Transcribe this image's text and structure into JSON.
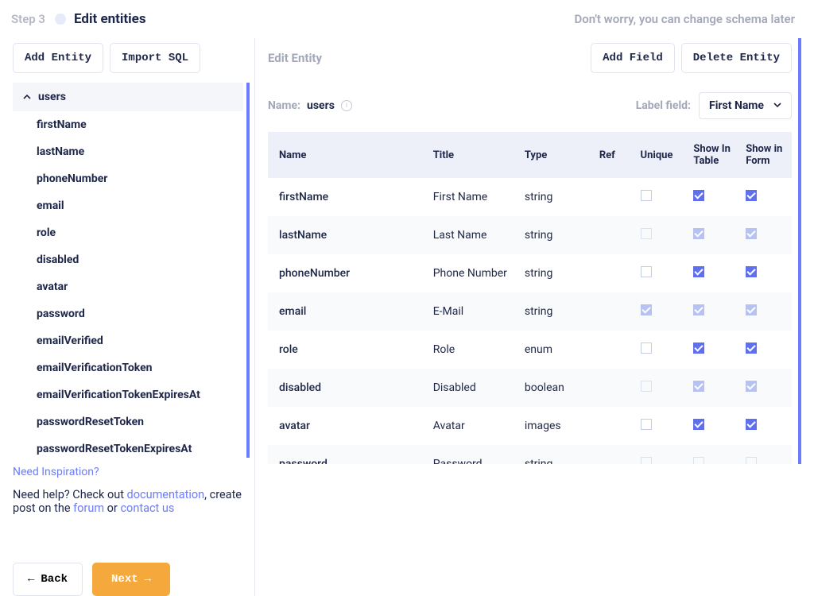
{
  "header": {
    "step_label": "Step 3",
    "title": "Edit entities",
    "subtitle": "Don't worry, you can change schema later"
  },
  "left": {
    "add_entity_label": "Add Entity",
    "import_sql_label": "Import SQL",
    "entity_name": "users",
    "fields": [
      "firstName",
      "lastName",
      "phoneNumber",
      "email",
      "role",
      "disabled",
      "avatar",
      "password",
      "emailVerified",
      "emailVerificationToken",
      "emailVerificationTokenExpiresAt",
      "passwordResetToken",
      "passwordResetTokenExpiresAt"
    ],
    "inspiration": "Need Inspiration?"
  },
  "right": {
    "edit_entity_label": "Edit Entity",
    "add_field_label": "Add Field",
    "delete_entity_label": "Delete Entity",
    "name_label": "Name:",
    "name_value": "users",
    "label_field_label": "Label field:",
    "label_field_value": "First Name",
    "columns": {
      "name": "Name",
      "title": "Title",
      "type": "Type",
      "ref": "Ref",
      "unique": "Unique",
      "show_in_table": "Show In Table",
      "show_in_form": "Show in Form"
    },
    "rows": [
      {
        "name": "firstName",
        "title": "First Name",
        "type": "string",
        "ref": "",
        "unique": false,
        "show_in_table": true,
        "show_in_form": true,
        "muted": false
      },
      {
        "name": "lastName",
        "title": "Last Name",
        "type": "string",
        "ref": "",
        "unique": false,
        "show_in_table": true,
        "show_in_form": true,
        "muted": true
      },
      {
        "name": "phoneNumber",
        "title": "Phone Number",
        "type": "string",
        "ref": "",
        "unique": false,
        "show_in_table": true,
        "show_in_form": true,
        "muted": false
      },
      {
        "name": "email",
        "title": "E-Mail",
        "type": "string",
        "ref": "",
        "unique": true,
        "show_in_table": true,
        "show_in_form": true,
        "muted": true
      },
      {
        "name": "role",
        "title": "Role",
        "type": "enum",
        "ref": "",
        "unique": false,
        "show_in_table": true,
        "show_in_form": true,
        "muted": false
      },
      {
        "name": "disabled",
        "title": "Disabled",
        "type": "boolean",
        "ref": "",
        "unique": false,
        "show_in_table": true,
        "show_in_form": true,
        "muted": true
      },
      {
        "name": "avatar",
        "title": "Avatar",
        "type": "images",
        "ref": "",
        "unique": false,
        "show_in_table": true,
        "show_in_form": true,
        "muted": false
      },
      {
        "name": "password",
        "title": "Password",
        "type": "string",
        "ref": "",
        "unique": false,
        "show_in_table": false,
        "show_in_form": false,
        "muted": true
      }
    ]
  },
  "help": {
    "prefix": "Need help? Check out ",
    "doc": "documentation",
    "mid1": ", create post on the ",
    "forum": "forum",
    "mid2": " or ",
    "contact": "contact us"
  },
  "footer": {
    "back_label": "Back",
    "next_label": "Next"
  }
}
